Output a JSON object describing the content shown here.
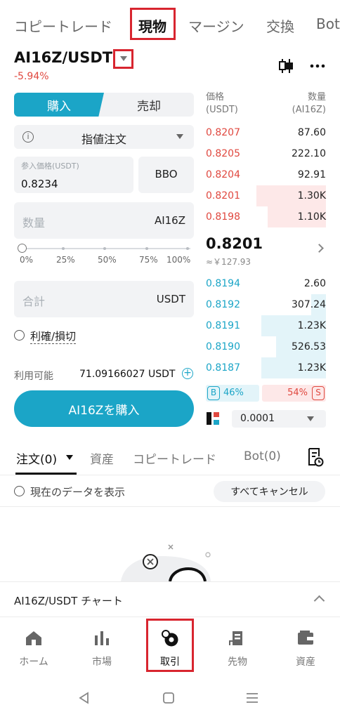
{
  "top_tabs": [
    "コピートレード",
    "現物",
    "マージン",
    "交換",
    "Bot"
  ],
  "pair": {
    "name": "AI16Z/USDT",
    "change": "-5.94%"
  },
  "trade": {
    "buy_tab": "購入",
    "sell_tab": "売却",
    "order_type": "指値注文",
    "price_placeholder": "参入価格(USDT)",
    "price_value": "0.8234",
    "bbo_label": "BBO",
    "qty_placeholder": "数量",
    "qty_unit": "AI16Z",
    "slider_labels": [
      "0%",
      "25%",
      "50%",
      "75%",
      "100%"
    ],
    "slider_value_percent": 0,
    "total_placeholder": "合計",
    "total_unit": "USDT",
    "tpsl_label": "利確/損切",
    "available_label": "利用可能",
    "available_value": "71.09166027 USDT",
    "buy_button": "AI16Zを購入"
  },
  "orderbook": {
    "price_header": [
      "価格",
      "(USDT)"
    ],
    "qty_header": [
      "数量",
      "(AI16Z)"
    ],
    "asks": [
      {
        "price": "0.8207",
        "qty": "87.60",
        "depth": 0
      },
      {
        "price": "0.8205",
        "qty": "222.10",
        "depth": 0
      },
      {
        "price": "0.8204",
        "qty": "92.91",
        "depth": 0
      },
      {
        "price": "0.8201",
        "qty": "1.30K",
        "depth": 0.56
      },
      {
        "price": "0.8198",
        "qty": "1.10K",
        "depth": 0.47
      }
    ],
    "last_price": "0.8201",
    "last_fiat": "≈￥127.93",
    "bids": [
      {
        "price": "0.8194",
        "qty": "2.60",
        "depth": 0
      },
      {
        "price": "0.8192",
        "qty": "307.24",
        "depth": 0.12
      },
      {
        "price": "0.8191",
        "qty": "1.23K",
        "depth": 0.52
      },
      {
        "price": "0.8190",
        "qty": "526.53",
        "depth": 0.4
      },
      {
        "price": "0.8187",
        "qty": "1.23K",
        "depth": 0.52
      }
    ],
    "buy_ratio_tag": "B",
    "buy_ratio": "46%",
    "sell_ratio": "54%",
    "sell_ratio_tag": "S",
    "depth_precision": "0.0001"
  },
  "orders": {
    "tabs": [
      "注文(0)",
      "資産",
      "コピートレード",
      "Bot(0)"
    ],
    "show_current": "現在のデータを表示",
    "cancel_all": "すべてキャンセル"
  },
  "chart_bar": {
    "label": "AI16Z/USDT チャート"
  },
  "bottom_nav": [
    {
      "label": "ホーム",
      "icon": "home-icon"
    },
    {
      "label": "市場",
      "icon": "bar-chart-icon"
    },
    {
      "label": "取引",
      "icon": "trade-icon"
    },
    {
      "label": "先物",
      "icon": "futures-icon"
    },
    {
      "label": "資産",
      "icon": "wallet-icon"
    }
  ],
  "colors": {
    "accent": "#1ba5c7",
    "sell": "#e0483f",
    "highlight": "#d8252f"
  }
}
